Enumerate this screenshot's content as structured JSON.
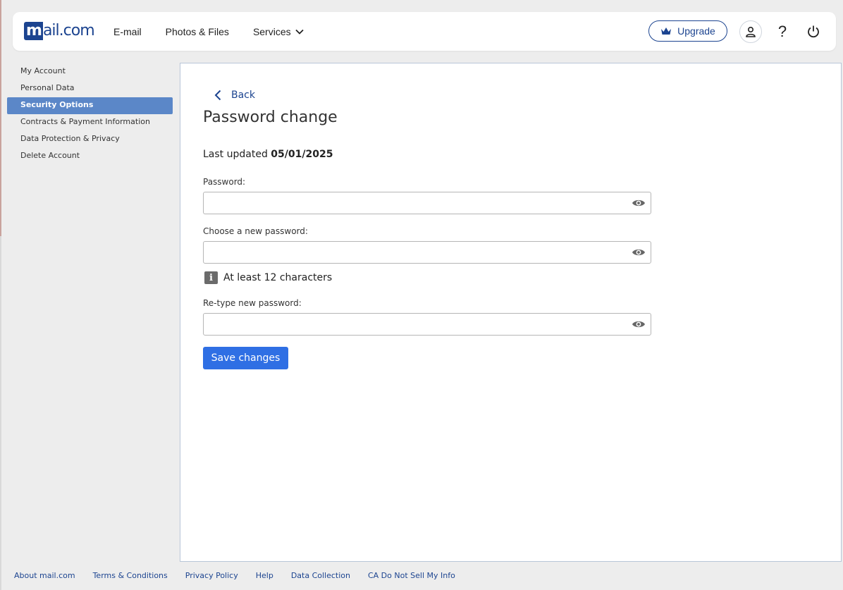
{
  "brand": {
    "logo_m": "m",
    "logo_rest": "ail.com",
    "color": "#1c4490"
  },
  "nav": {
    "items": [
      {
        "label": "E-mail"
      },
      {
        "label": "Photos & Files"
      },
      {
        "label": "Services",
        "has_dropdown": true
      }
    ]
  },
  "header": {
    "upgrade_label": "Upgrade",
    "icons": [
      "crown-icon",
      "user-icon",
      "help-icon",
      "power-icon"
    ],
    "help_glyph": "?"
  },
  "sidebar": {
    "items": [
      {
        "label": "My Account",
        "active": false
      },
      {
        "label": "Personal Data",
        "active": false
      },
      {
        "label": "Security Options",
        "active": true
      },
      {
        "label": "Contracts & Payment Information",
        "active": false
      },
      {
        "label": "Data Protection & Privacy",
        "active": false
      },
      {
        "label": "Delete Account",
        "active": false
      }
    ],
    "active_color": "#5b87c8"
  },
  "main": {
    "back_label": "Back",
    "title": "Password change",
    "last_updated_label": "Last updated",
    "last_updated_value": "05/01/2025",
    "fields": {
      "current": {
        "label": "Password:",
        "value": ""
      },
      "new": {
        "label": "Choose a new password:",
        "value": ""
      },
      "retype": {
        "label": "Re-type new password:",
        "value": ""
      }
    },
    "hint": "At least 12 characters",
    "save_label": "Save changes",
    "save_color": "#2f6fe4"
  },
  "footer": {
    "links": [
      {
        "label": "About mail.com"
      },
      {
        "label": "Terms & Conditions"
      },
      {
        "label": "Privacy Policy"
      },
      {
        "label": "Help"
      },
      {
        "label": "Data Collection"
      },
      {
        "label": "CA Do Not Sell My Info"
      }
    ]
  }
}
